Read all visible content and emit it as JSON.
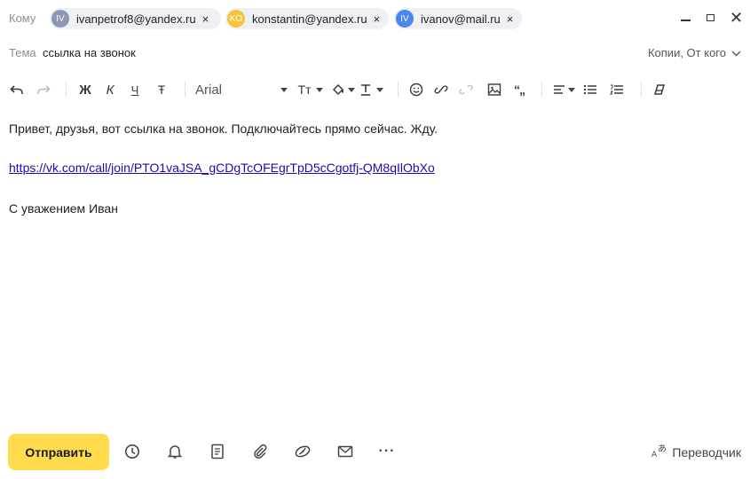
{
  "header": {
    "to_label": "Кому",
    "recipients": [
      {
        "initials": "IV",
        "email": "ivanpetrof8@yandex.ru",
        "avatar_color": "#8e96b4",
        "remove": "×"
      },
      {
        "initials": "KO",
        "email": "konstantin@yandex.ru",
        "avatar_color": "#f7c33a",
        "remove": "×"
      },
      {
        "initials": "IV",
        "email": "ivanov@mail.ru",
        "avatar_color": "#4a85f0",
        "remove": "×"
      }
    ],
    "close_glyph": "✕"
  },
  "subject": {
    "label": "Тема",
    "value": "ссылка на звонок",
    "copies_label": "Копии, От кого"
  },
  "toolbar": {
    "bold": "Ж",
    "italic": "К",
    "underline": "Ч",
    "strike": "Ŧ",
    "font_name": "Arial",
    "text_size": "Tт",
    "quote": "“„",
    "icons": [
      "undo-icon",
      "redo-icon",
      "bold-icon",
      "italic-icon",
      "underline-icon",
      "strikethrough-icon",
      "font-select",
      "text-size-icon",
      "fill-color-icon",
      "text-color-icon",
      "emoji-icon",
      "link-icon",
      "unlink-icon",
      "image-icon",
      "quote-icon",
      "align-icon",
      "bullet-list-icon",
      "numbered-list-icon",
      "clear-format-icon"
    ]
  },
  "body": {
    "line1": "Привет, друзья, вот ссылка на звонок. Подключайтесь прямо сейчас. Жду.",
    "link": "https://vk.com/call/join/PTO1vaJSA_gCDgTcOFEgrTpD5cCgotfj-QM8qIlObXo",
    "signature": "С уважением Иван"
  },
  "footer": {
    "send_label": "Отправить",
    "more_label": "···",
    "translator_label": "Переводчик",
    "icons": [
      "clock-icon",
      "bell-icon",
      "template-icon",
      "attach-icon",
      "disk-icon",
      "envelope-icon",
      "more-icon",
      "translate-icon"
    ]
  },
  "colors": {
    "send_button": "#ffdb4d",
    "link": "#1a0dab",
    "chip_bg": "#eef0f3"
  }
}
